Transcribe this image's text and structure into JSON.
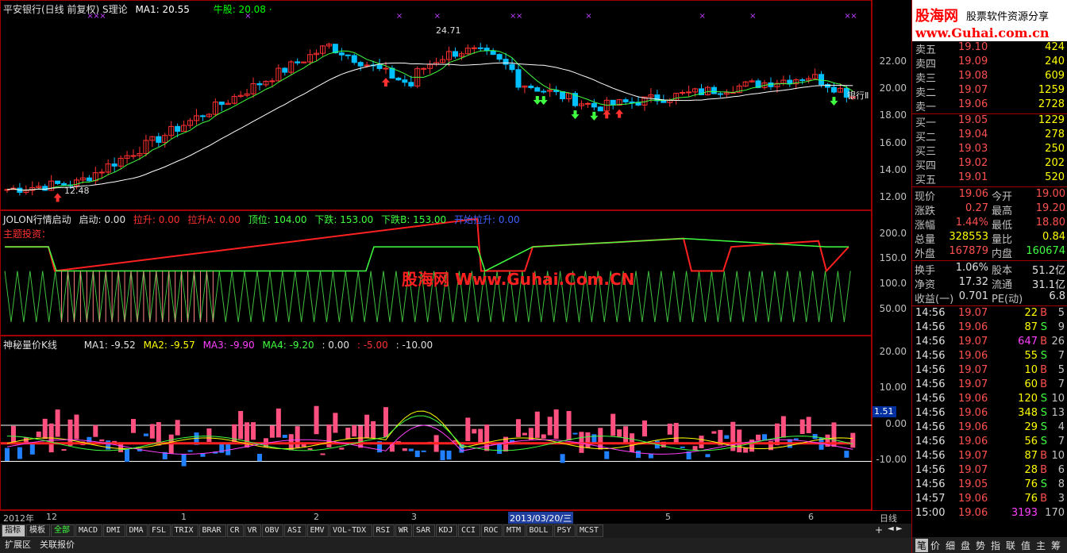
{
  "panel1": {
    "title": "平安银行(日线 前复权) S理论",
    "ma1": "MA1: 20.55",
    "niugu": "牛股: 20.08 ·",
    "ticks": [
      "22.00",
      "20.00",
      "18.00",
      "16.00",
      "14.00",
      "12.00"
    ],
    "high_label": "24.71",
    "low_label": "12.48",
    "side_label": "银行Ⅱ"
  },
  "panel2": {
    "title": "JOLON行情启动",
    "items": [
      "启动: 0.00",
      "拉升: 0.00",
      "拉升A: 0.00",
      "顶位: 104.00",
      "下跌: 153.00",
      "下跌B: 153.00",
      "开始拉升: 0.00"
    ],
    "sub": "主题投资：",
    "ticks": [
      "200.0",
      "150.0",
      "100.0",
      "50.00"
    ],
    "watermark": "股海网 Www.Guhai.Com.CN"
  },
  "panel3": {
    "title": "神秘量价K线",
    "items": [
      "MA1: -9.52",
      "MA2: -9.57",
      "MA3: -9.90",
      "MA4: -9.20",
      ": 0.00",
      ": -5.00",
      ": -10.00"
    ],
    "ticks": [
      "20.00",
      "10.00",
      "0.00",
      "-10.00"
    ],
    "badge": "1.51"
  },
  "xaxis": {
    "labels": [
      "2012年",
      "12",
      "1",
      "2",
      "3",
      "2013/03/20/三",
      "5",
      "6"
    ],
    "right": "日线"
  },
  "tabs": [
    "指标",
    "模板",
    "全部",
    "MACD",
    "DMI",
    "DMA",
    "FSL",
    "TRIX",
    "BRAR",
    "CR",
    "VR",
    "OBV",
    "ASI",
    "EMV",
    "VOL-TDX",
    "RSI",
    "WR",
    "SAR",
    "KDJ",
    "CCI",
    "ROC",
    "MTM",
    "BOLL",
    "PSY",
    "MCST"
  ],
  "bottom_tabs": [
    "扩展区",
    "关联报价"
  ],
  "banner": {
    "title": "股海网",
    "slogan": "股票软件资源分享",
    "url": "www.Guhai.com.cn"
  },
  "asks": [
    {
      "label": "卖五",
      "price": "19.10",
      "vol": "424"
    },
    {
      "label": "卖四",
      "price": "19.09",
      "vol": "240"
    },
    {
      "label": "卖三",
      "price": "19.08",
      "vol": "609"
    },
    {
      "label": "卖二",
      "price": "19.07",
      "vol": "1259"
    },
    {
      "label": "卖一",
      "price": "19.06",
      "vol": "2728"
    }
  ],
  "bids": [
    {
      "label": "买一",
      "price": "19.05",
      "vol": "1229"
    },
    {
      "label": "买二",
      "price": "19.04",
      "vol": "278"
    },
    {
      "label": "买三",
      "price": "19.03",
      "vol": "250"
    },
    {
      "label": "买四",
      "price": "19.02",
      "vol": "202"
    },
    {
      "label": "买五",
      "price": "19.01",
      "vol": "520"
    }
  ],
  "stats": [
    {
      "l1": "现价",
      "v1": "19.06",
      "l2": "今开",
      "v2": "19.00"
    },
    {
      "l1": "涨跌",
      "v1": "0.27",
      "l2": "最高",
      "v2": "19.20"
    },
    {
      "l1": "涨幅",
      "v1": "1.44%",
      "l2": "最低",
      "v2": "18.80"
    },
    {
      "l1": "总量",
      "v1": "328553",
      "l2": "量比",
      "v2": "0.84"
    },
    {
      "l1": "外盘",
      "v1": "167879",
      "l2": "内盘",
      "v2": "160674"
    },
    {
      "l1": "换手",
      "v1": "1.06%",
      "l2": "股本",
      "v2": "51.2亿"
    },
    {
      "l1": "净资",
      "v1": "17.32",
      "l2": "流通",
      "v2": "31.1亿"
    },
    {
      "l1": "收益(一)",
      "v1": "0.701",
      "l2": "PE(动)",
      "v2": "6.8"
    }
  ],
  "ticks_list": [
    {
      "t": "14:56",
      "p": "19.07",
      "v": "22",
      "bs": "B",
      "n": "5"
    },
    {
      "t": "14:56",
      "p": "19.06",
      "v": "87",
      "bs": "S",
      "n": "9"
    },
    {
      "t": "14:56",
      "p": "19.07",
      "v": "647",
      "bs": "B",
      "n": "26"
    },
    {
      "t": "14:56",
      "p": "19.06",
      "v": "55",
      "bs": "S",
      "n": "7"
    },
    {
      "t": "14:56",
      "p": "19.07",
      "v": "10",
      "bs": "B",
      "n": "5"
    },
    {
      "t": "14:56",
      "p": "19.07",
      "v": "60",
      "bs": "B",
      "n": "7"
    },
    {
      "t": "14:56",
      "p": "19.06",
      "v": "120",
      "bs": "S",
      "n": "10"
    },
    {
      "t": "14:56",
      "p": "19.06",
      "v": "348",
      "bs": "S",
      "n": "13"
    },
    {
      "t": "14:56",
      "p": "19.06",
      "v": "29",
      "bs": "S",
      "n": "4"
    },
    {
      "t": "14:56",
      "p": "19.06",
      "v": "56",
      "bs": "S",
      "n": "7"
    },
    {
      "t": "14:56",
      "p": "19.07",
      "v": "87",
      "bs": "B",
      "n": "10"
    },
    {
      "t": "14:56",
      "p": "19.07",
      "v": "28",
      "bs": "B",
      "n": "6"
    },
    {
      "t": "14:56",
      "p": "19.05",
      "v": "76",
      "bs": "S",
      "n": "8"
    },
    {
      "t": "14:57",
      "p": "19.06",
      "v": "76",
      "bs": "B",
      "n": "3"
    },
    {
      "t": "15:00",
      "p": "19.06",
      "v": "3193",
      "bs": "",
      "n": "170"
    }
  ],
  "right_bottom": [
    "笔",
    "价",
    "细",
    "盘",
    "势",
    "指",
    "联",
    "值",
    "主",
    "筹"
  ]
}
